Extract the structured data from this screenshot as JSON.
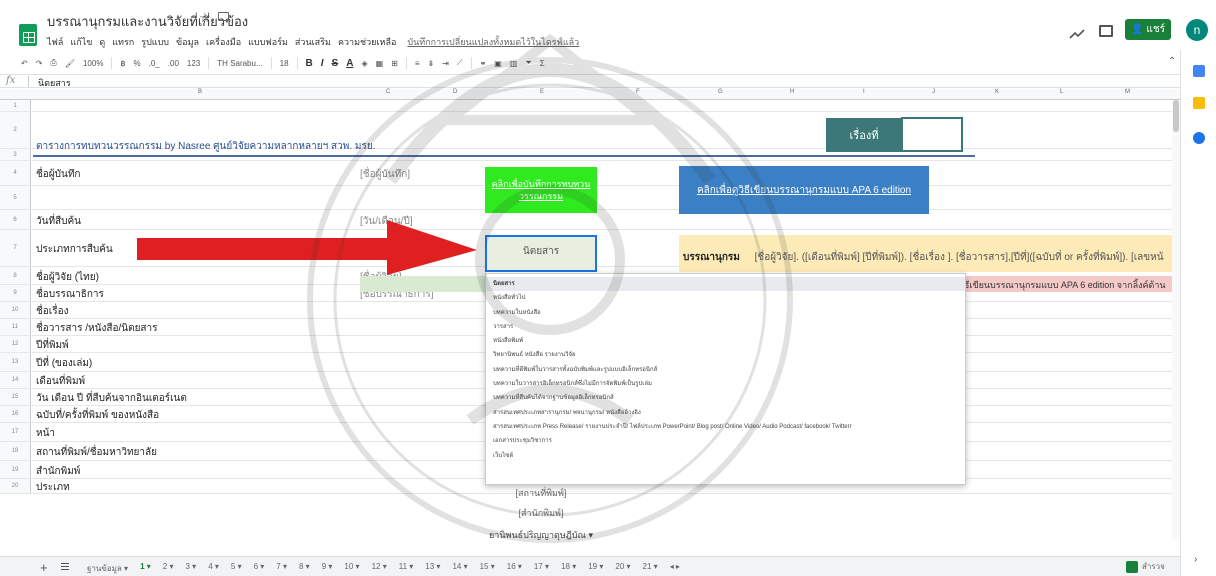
{
  "header": {
    "title": "บรรณานุกรมและงานวิจัยที่เกี่ยวข้อง",
    "star": "☆",
    "menu": [
      "ไฟล์",
      "แก้ไข",
      "ดู",
      "แทรก",
      "รูปแบบ",
      "ข้อมูล",
      "เครื่องมือ",
      "แบบฟอร์ม",
      "ส่วนเสริม",
      "ความช่วยเหลือ"
    ],
    "last_edit": "บันทึกการเปลี่ยนแปลงทั้งหมดไว้ในไดรฟ์แล้ว",
    "share_label": "แชร์",
    "avatar_letter": "n",
    "colors": {
      "share": "#188038",
      "avatar": "#00897b"
    }
  },
  "toolbar": {
    "zoom": "100%",
    "currency": "฿",
    "percent": "%",
    "dec_less": ".0_",
    "dec_more": ".00",
    "format": "123",
    "font": "TH Sarabu...",
    "font_size": "18",
    "bold": "B",
    "italic": "I",
    "strike": "S",
    "text_color": "A"
  },
  "formula_bar": {
    "fx": "fx",
    "value": "นิตยสาร"
  },
  "columns": [
    "B",
    "C",
    "D",
    "E",
    "F",
    "G",
    "H",
    "I",
    "J",
    "K",
    "L",
    "M"
  ],
  "rows": [
    {
      "n": "1",
      "label": "",
      "c": ""
    },
    {
      "n": "2",
      "label": "",
      "c": ""
    },
    {
      "n": "3",
      "label": "",
      "c": ""
    },
    {
      "n": "4",
      "label": "ชื่อผู้บันทึก",
      "c": "[ชื่อผู้บันทึก]"
    },
    {
      "n": "5",
      "label": "",
      "c": ""
    },
    {
      "n": "6",
      "label": "วันที่สืบค้น",
      "c": "[วัน/เดือน/ปี]"
    },
    {
      "n": "7",
      "label": "ประเภทการสืบค้น",
      "c": ""
    },
    {
      "n": "8",
      "label": "ชื่อผู้วิจัย (ไทย)",
      "c": "[ชื่อผู้วิจัย]"
    },
    {
      "n": "9",
      "label": "ชื่อบรรณาธิการ",
      "c": "[ชื่อบรรณาธิการ]"
    },
    {
      "n": "10",
      "label": "ชื่อเรื่อง",
      "c": ""
    },
    {
      "n": "11",
      "label": "ชื่อวารสาร /หนังสือ/นิตยสาร",
      "c": ""
    },
    {
      "n": "12",
      "label": "ปีที่พิมพ์",
      "c": ""
    },
    {
      "n": "13",
      "label": "ปีที่ (ของเล่ม)",
      "c": ""
    },
    {
      "n": "14",
      "label": "เดือนที่พิมพ์",
      "c": ""
    },
    {
      "n": "15",
      "label": "วัน เดือน ปี ที่สืบค้นจากอินเตอร์เนต",
      "c": ""
    },
    {
      "n": "16",
      "label": "ฉบับที่/ครั้งที่พิมพ์ ของหนังสือ",
      "c": ""
    },
    {
      "n": "17",
      "label": "หน้า",
      "c": ""
    },
    {
      "n": "18",
      "label": "สถานที่พิมพ์/ชื่อมหาวิทยาลัย",
      "c": ""
    },
    {
      "n": "19",
      "label": "สำนักพิมพ์",
      "c": ""
    },
    {
      "n": "20",
      "label": "ประเภท",
      "c": ""
    }
  ],
  "sheet": {
    "report_title": "ตารางการทบทวนวรรณกรรม by Nasree ศูนย์วิจัยความหลากหลายฯ สวพ. มรย.",
    "story_label": "เรื่องที่",
    "green_link": "คลิกเพื่อบันทึกการทบทวนวรรณกรรม",
    "blue_link": "คลิกเพื่อดูวิธีเขียนบรรณานุกรมแบบ APA 6 edition",
    "type_value": "นิตยสาร",
    "biblio_label": "บรรณานุกรม",
    "biblio_text": "[ชื่อผู้วิจัย]. ([เดือนที่พิมพ์] [ปีที่พิมพ์]). [ชื่อเรื่อง ]. [ชื่อวารสาร],[ปีที่]([ฉบับที่ or ครั้งที่พิมพ์]). [เลขหน้",
    "pink_text": "ดูวิธีเขียนบรรณานุกรมแบบ APA 6 edition จากลิ้งค์ด้าน",
    "place_value": "[สถานที่พิมพ์]",
    "publisher_value": "[สำนักพิมพ์]",
    "type_row_value": "ยานิพนธ์ปริญญาดุษฎีบัณ",
    "colors": {
      "story": "#3d7878",
      "green": "#2eea1e",
      "blue": "#3b7fc4",
      "biblio": "#fcebb6",
      "pink": "#f6c9c9",
      "arrow": "#e02020"
    }
  },
  "dropdown": {
    "options": [
      "นิตยสาร",
      "หนังสือทั่วไป",
      "บทความในหนังสือ",
      "วารสาร",
      "หนังสือพิมพ์",
      "วิทยานิพนธ์ หนังสือ รายงานวิจัย",
      "บทความที่ตีพิมพ์ในวารสารทั้งฉบับพิมพ์และรูปแบบอิเล็กทรอนิกส์",
      "บทความในวารสารอิเล็กทรอนิกส์ซึ่งไม่มีการจัดพิมพ์เป็นรูปเล่ม",
      "บทความที่สืบค้นได้จากฐานข้อมูลอิเล็กทรอนิกส์",
      "สารสนเทศประเภทสารานุกรม/ พจนานุกรม/ หนังสืออ้างอิง",
      "สารสนเทศประเภท Press Release/ รายงานประจำปี/ ไฟล์ประเภท PowerPoint/ Blog post/ Online Video/ Audio Podcast/ facebook/ Twitterr",
      "เอกสารประชุมวิชาการ",
      "เว็บไซต์"
    ],
    "selected_index": 0
  },
  "sheet_tabs": {
    "items": [
      "ฐานข้อมูล",
      "1",
      "2",
      "3",
      "4",
      "5",
      "6",
      "7",
      "8",
      "9",
      "10",
      "12",
      "11",
      "13",
      "14",
      "15",
      "16",
      "17",
      "18",
      "19",
      "20",
      "21"
    ],
    "active_index": 1,
    "explore_label": "สำรวจ"
  }
}
